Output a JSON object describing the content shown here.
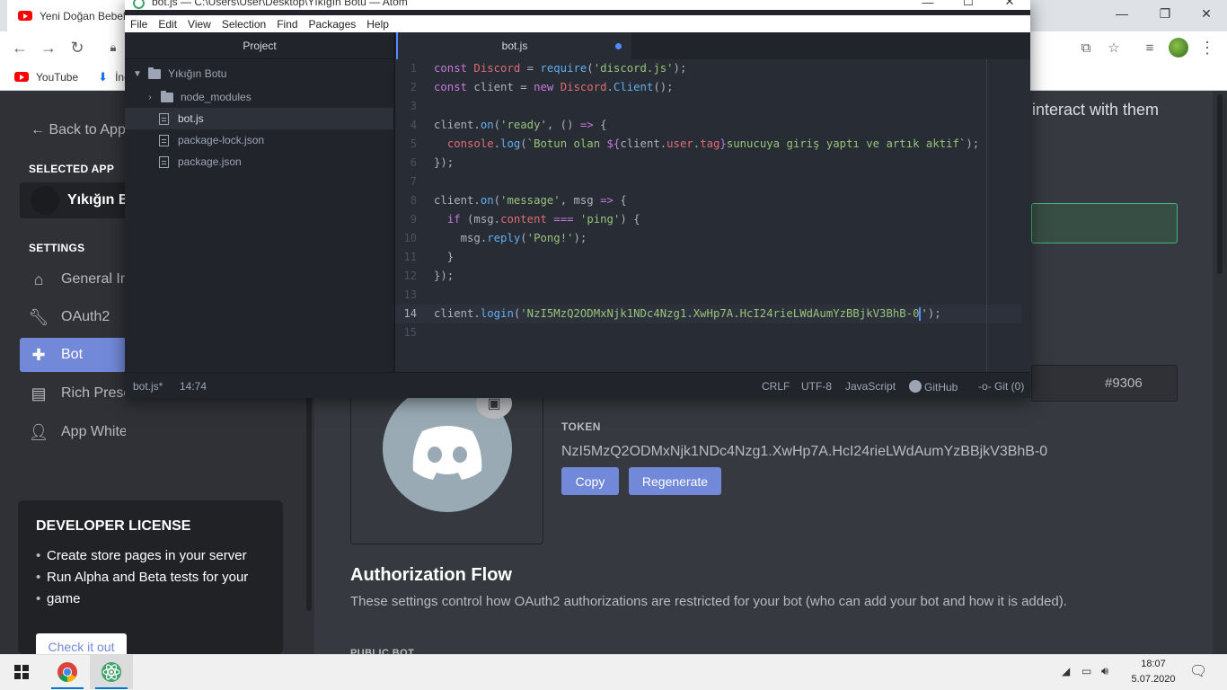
{
  "browser": {
    "tab_title": "Yeni Doğan Bebek",
    "bookmarks": [
      "YouTube",
      "İnd"
    ],
    "colors": {
      "youtube_red": "#ff0000"
    }
  },
  "discord": {
    "back_link": "← Back to Appli",
    "selected_app_heading": "SELECTED APP",
    "app_name": "Yıkığın Bo",
    "settings_heading": "SETTINGS",
    "nav": [
      {
        "label": "General In",
        "icon": "home-icon"
      },
      {
        "label": "OAuth2",
        "icon": "wrench-icon"
      },
      {
        "label": "Bot",
        "icon": "puzzle-icon",
        "active": true
      },
      {
        "label": "Rich Prese",
        "icon": "rich-presence-icon"
      },
      {
        "label": "App Whitelist",
        "icon": "user-icon"
      }
    ],
    "developer_license": {
      "title": "DEVELOPER LICENSE",
      "items": [
        "Create store pages in your server",
        "Run Alpha and Beta tests for your",
        "game"
      ],
      "button": "Check it out"
    },
    "intro_fragment": "interact with them",
    "discriminator": "#9306",
    "token_label": "TOKEN",
    "token_value": "NzI5MzQ2ODMxNjk1NDc4Nzg1.XwHp7A.HcI24rieLWdAumYzBBjkV3BhB-0",
    "copy_button": "Copy",
    "regenerate_button": "Regenerate",
    "auth_title": "Authorization Flow",
    "auth_desc": "These settings control how OAuth2 authorizations are restricted for your bot (who can add your bot and how it is added).",
    "public_bot_label": "PUBLIC BOT",
    "colors": {
      "blurple": "#7289da",
      "sidebar": "#2f3136",
      "main": "#36393f"
    }
  },
  "atom": {
    "title": "bot.js — C:\\Users\\User\\Desktop\\Yıkığın Botu — Atom",
    "menu": [
      "File",
      "Edit",
      "View",
      "Selection",
      "Find",
      "Packages",
      "Help"
    ],
    "tree_header": "Project",
    "root_folder": "Yıkığın Botu",
    "tree": [
      {
        "label": "node_modules",
        "type": "folder"
      },
      {
        "label": "bot.js",
        "type": "file",
        "selected": true
      },
      {
        "label": "package-lock.json",
        "type": "file"
      },
      {
        "label": "package.json",
        "type": "file"
      }
    ],
    "tab_label": "bot.js",
    "line_numbers": [
      "1",
      "2",
      "3",
      "4",
      "5",
      "6",
      "7",
      "8",
      "9",
      "10",
      "11",
      "12",
      "13",
      "14",
      "15"
    ],
    "status": {
      "file": "bot.js*",
      "cursor": "14:74",
      "line_ending": "CRLF",
      "encoding": "UTF-8",
      "grammar": "JavaScript",
      "github": "GitHub",
      "git": "Git (0)"
    }
  },
  "taskbar": {
    "time": "18:07",
    "date": "5.07.2020"
  }
}
